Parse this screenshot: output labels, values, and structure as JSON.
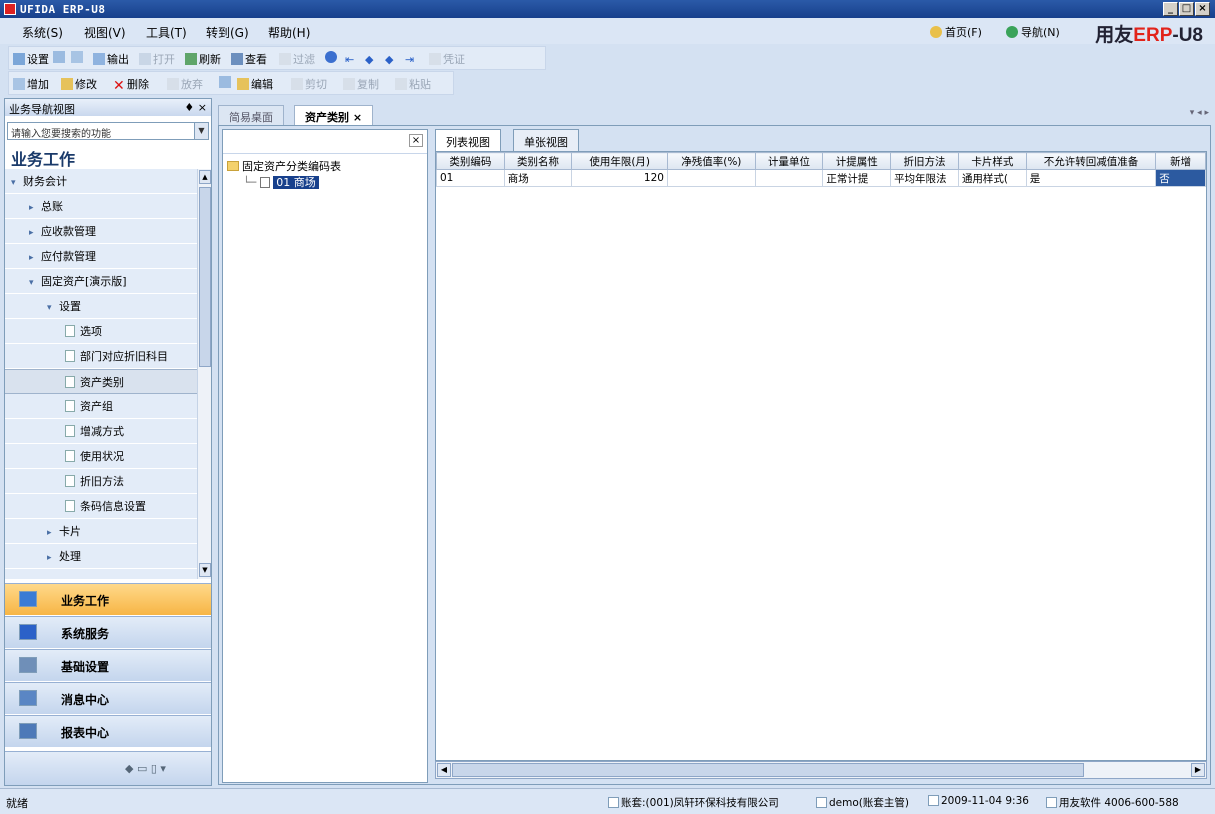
{
  "window": {
    "title": "UFIDA ERP-U8",
    "controls": [
      "_",
      "□",
      "×"
    ]
  },
  "menu": {
    "items": [
      "系统(S)",
      "视图(V)",
      "工具(T)",
      "转到(G)",
      "帮助(H)"
    ],
    "nav_home": "首页(F)",
    "nav_guide": "导航(N)",
    "brand_prefix": "用友",
    "brand_erp": "ERP",
    "brand_suffix": "-U8"
  },
  "toolbar1": {
    "items": [
      {
        "label": "设置",
        "enabled": true
      },
      {
        "label": "",
        "enabled": true
      },
      {
        "label": "",
        "enabled": true
      },
      {
        "label": "输出",
        "enabled": true
      },
      {
        "label": "打开",
        "enabled": false
      },
      {
        "label": "刷新",
        "enabled": true
      },
      {
        "label": "查看",
        "enabled": true
      },
      {
        "label": "过滤",
        "enabled": false
      },
      {
        "label": "凭证",
        "enabled": false
      }
    ]
  },
  "toolbar2": {
    "items": [
      {
        "label": "增加",
        "enabled": true
      },
      {
        "label": "修改",
        "enabled": true
      },
      {
        "label": "删除",
        "enabled": true
      },
      {
        "label": "放弃",
        "enabled": false
      },
      {
        "label": "编辑",
        "enabled": true
      },
      {
        "label": "剪切",
        "enabled": false
      },
      {
        "label": "复制",
        "enabled": false
      },
      {
        "label": "粘贴",
        "enabled": false
      }
    ]
  },
  "nav": {
    "header": "业务导航视图",
    "pin": "♦ ×",
    "search_placeholder": "请输入您要搜索的功能",
    "title": "业务工作",
    "tree": [
      {
        "label": "财务会计",
        "level": 0,
        "expanded": true
      },
      {
        "label": "总账",
        "level": 1,
        "expanded": false
      },
      {
        "label": "应收款管理",
        "level": 1,
        "expanded": false
      },
      {
        "label": "应付款管理",
        "level": 1,
        "expanded": false
      },
      {
        "label": "固定资产[演示版]",
        "level": 1,
        "expanded": true
      },
      {
        "label": "设置",
        "level": 2,
        "expanded": true
      },
      {
        "label": "选项",
        "level": 3,
        "doc": true
      },
      {
        "label": "部门对应折旧科目",
        "level": 3,
        "doc": true
      },
      {
        "label": "资产类别",
        "level": 3,
        "doc": true,
        "selected": true
      },
      {
        "label": "资产组",
        "level": 3,
        "doc": true
      },
      {
        "label": "增减方式",
        "level": 3,
        "doc": true
      },
      {
        "label": "使用状况",
        "level": 3,
        "doc": true
      },
      {
        "label": "折旧方法",
        "level": 3,
        "doc": true
      },
      {
        "label": "条码信息设置",
        "level": 3,
        "doc": true
      },
      {
        "label": "卡片",
        "level": 2,
        "expanded": false
      },
      {
        "label": "处理",
        "level": 2,
        "expanded": false
      }
    ],
    "outlook": [
      {
        "label": "业务工作",
        "active": true,
        "color": "#3a7bd5"
      },
      {
        "label": "系统服务",
        "active": false,
        "color": "#2b61c8"
      },
      {
        "label": "基础设置",
        "active": false,
        "color": "#6f8fb8"
      },
      {
        "label": "消息中心",
        "active": false,
        "color": "#5a86c4"
      },
      {
        "label": "报表中心",
        "active": false,
        "color": "#4d79b8"
      }
    ]
  },
  "tabs": [
    {
      "label": "简易桌面",
      "active": false
    },
    {
      "label": "资产类别 ×",
      "active": true
    }
  ],
  "tabnav": "▾ ◂ ▸",
  "category_tree": {
    "close": "×",
    "root": "固定资产分类编码表",
    "child": "01 商场"
  },
  "view_tabs": [
    {
      "label": "列表视图",
      "active": true
    },
    {
      "label": "单张视图",
      "active": false
    }
  ],
  "grid": {
    "columns": [
      "类别编码",
      "类别名称",
      "使用年限(月)",
      "净残值率(%)",
      "计量单位",
      "计提属性",
      "折旧方法",
      "卡片样式",
      "不允许转回减值准备",
      "新增"
    ],
    "rows": [
      [
        "01",
        "商场",
        "120",
        "",
        "",
        "正常计提",
        "平均年限法",
        "通用样式(",
        "是",
        "否"
      ]
    ]
  },
  "status": {
    "left": "就绪",
    "account": "账套:(001)凤轩环保科技有限公司",
    "user": "demo(账套主管)",
    "datetime": "2009-11-04 9:36",
    "support": "用友软件 4006-600-588"
  }
}
